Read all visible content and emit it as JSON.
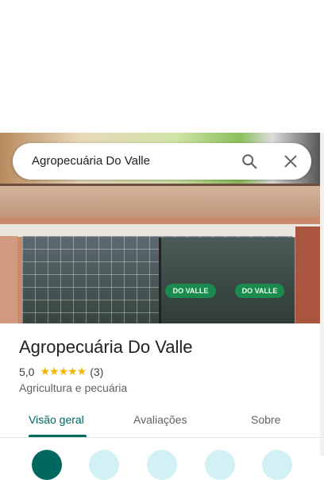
{
  "search": {
    "query": "Agropecuária Do Valle"
  },
  "photo": {
    "sign_left": "DO VALLE",
    "sign_right": "DO VALLE"
  },
  "place": {
    "name": "Agropecuária Do Valle",
    "rating": "5,0",
    "stars": "★★★★★",
    "review_count": "(3)",
    "category": "Agricultura e pecuária"
  },
  "tabs": [
    {
      "label": "Visão geral",
      "active": true
    },
    {
      "label": "Avaliações",
      "active": false
    },
    {
      "label": "Sobre",
      "active": false
    }
  ],
  "colors": {
    "accent": "#00685e",
    "star": "#f4b400",
    "action_bg": "#d2f1f4"
  },
  "icons": [
    "search-icon",
    "close-icon"
  ]
}
